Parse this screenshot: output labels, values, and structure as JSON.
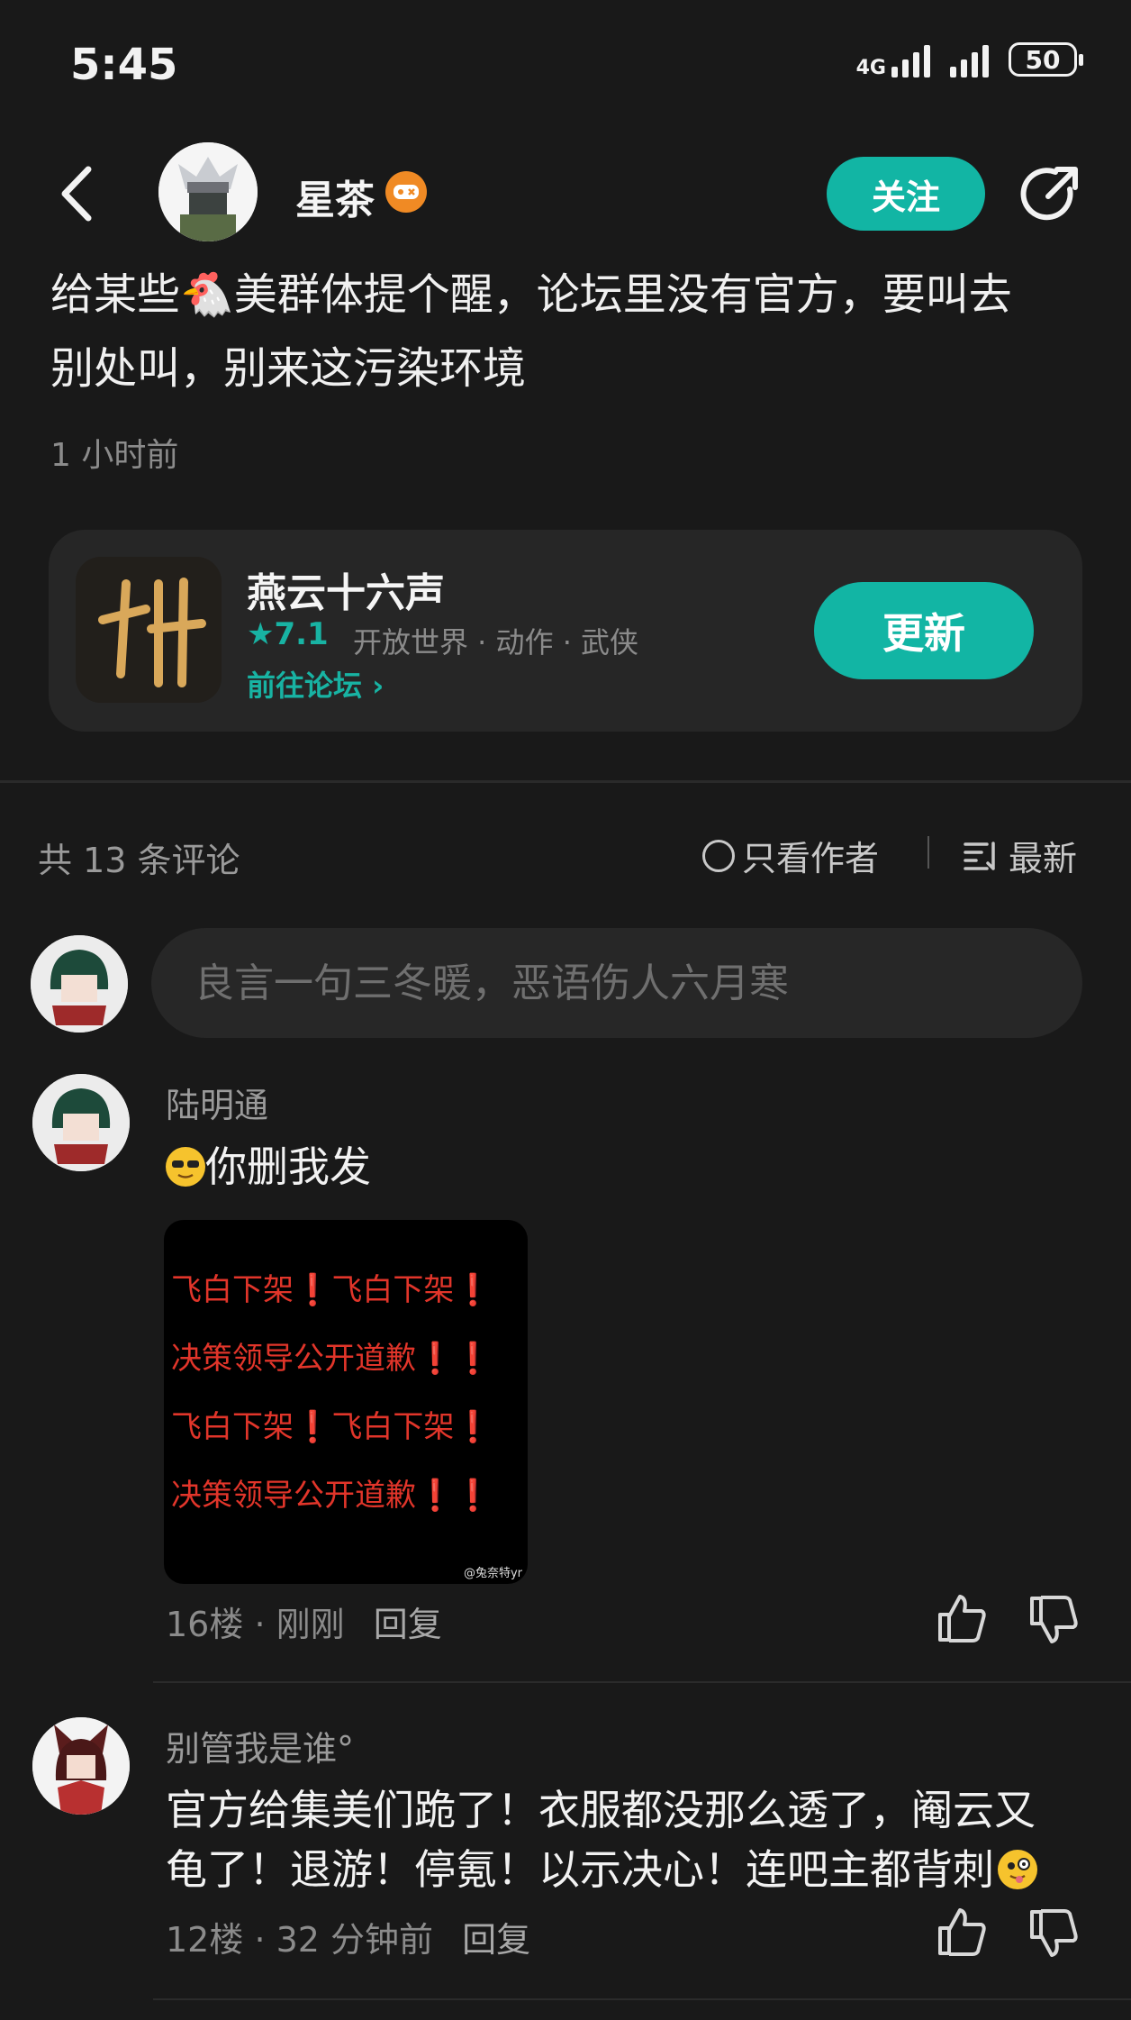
{
  "status_bar": {
    "time": "5:45",
    "network_label": "4G",
    "battery": "50"
  },
  "header": {
    "author_name": "星茶",
    "follow_label": "关注"
  },
  "post": {
    "text_line1": "给某些🐔美群体提个醒，论坛里没有官方，要叫去",
    "text_line2": "别处叫，别来这污染环境",
    "time": "1 小时前"
  },
  "game_card": {
    "title": "燕云十六声",
    "rating": "★7.1",
    "tags": "开放世界 · 动作 · 武侠",
    "forum_link": "前往论坛 ›",
    "update_label": "更新"
  },
  "comments_header": {
    "count": "共 13 条评论",
    "only_author": "只看作者",
    "sort": "最新"
  },
  "comment_input": {
    "placeholder": "良言一句三冬暖，恶语伤人六月寒"
  },
  "comments": [
    {
      "user": "陆明通",
      "text": "你删我发",
      "image_lines": [
        "飞白下架❗飞白下架❗",
        "决策领导公开道歉❗❗",
        "飞白下架❗飞白下架❗",
        "决策领导公开道歉❗❗"
      ],
      "image_watermark": "@兔奈特yr",
      "floor": "16楼",
      "time": "刚刚",
      "reply": "回复"
    },
    {
      "user": "别管我是谁°",
      "text_line1": "官方给集美们跪了！衣服都没那么透了，阉云又",
      "text_line2": "龟了！退游！停氪！以示决心！连吧主都背刺",
      "floor": "12楼",
      "time": "32 分钟前",
      "reply": "回复"
    }
  ],
  "colors": {
    "accent": "#12b5a4",
    "background": "#191919",
    "badge": "#f08a24"
  }
}
